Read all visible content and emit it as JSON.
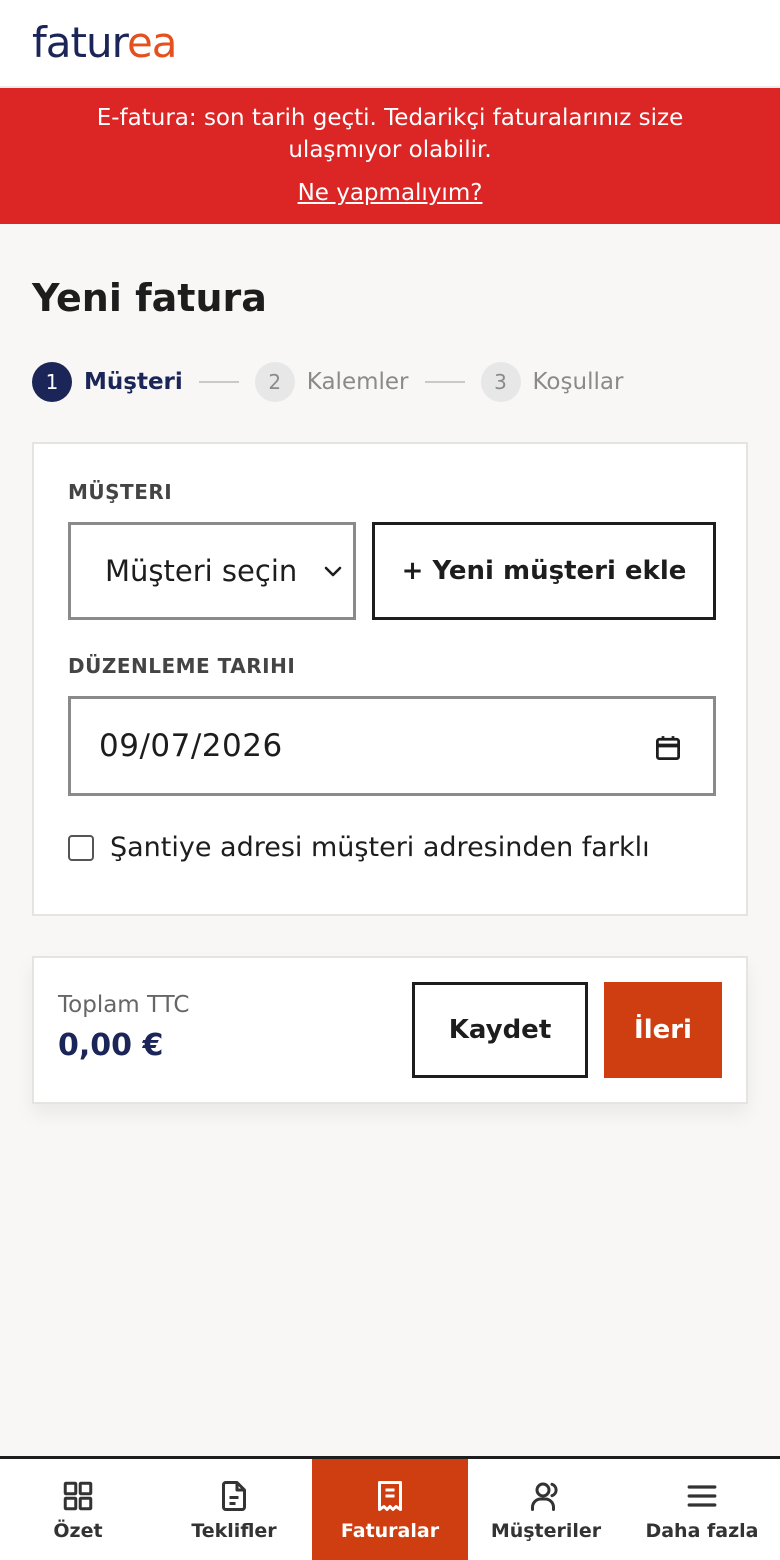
{
  "brand": {
    "part1": "fatur",
    "part2": "ea"
  },
  "banner": {
    "message": "E-fatura: son tarih geçti. Tedarikçi faturalarınız size ulaşmıyor olabilir.",
    "link": "Ne yapmalıyım?"
  },
  "page": {
    "title": "Yeni fatura"
  },
  "stepper": {
    "steps": [
      {
        "num": "1",
        "label": "Müşteri",
        "state": "active"
      },
      {
        "num": "2",
        "label": "Kalemler",
        "state": "todo"
      },
      {
        "num": "3",
        "label": "Koşullar",
        "state": "todo"
      }
    ]
  },
  "form": {
    "customer_label": "MÜŞTERI",
    "customer_select_value": "Müşteri seçin",
    "new_customer_button": "+ Yeni müşteri ekle",
    "date_label": "DÜZENLEME TARIHI",
    "date_value": "09/07/2026",
    "site_address_checkbox": "Şantiye adresi müşteri adresinden farklı",
    "site_address_checked": false
  },
  "summary": {
    "total_label": "Toplam TTC",
    "total_value": "0,00 €",
    "save_button": "Kaydet",
    "next_button": "İleri"
  },
  "nav": {
    "items": [
      {
        "label": "Özet",
        "icon": "grid-icon",
        "active": false
      },
      {
        "label": "Teklifler",
        "icon": "document-icon",
        "active": false
      },
      {
        "label": "Faturalar",
        "icon": "receipt-icon",
        "active": true
      },
      {
        "label": "Müşteriler",
        "icon": "users-icon",
        "active": false
      },
      {
        "label": "Daha fazla",
        "icon": "menu-icon",
        "active": false
      }
    ]
  },
  "colors": {
    "brand_navy": "#1b2557",
    "brand_orange": "#e4511f",
    "banner_red": "#dc2626",
    "accent": "#cf3e11"
  }
}
